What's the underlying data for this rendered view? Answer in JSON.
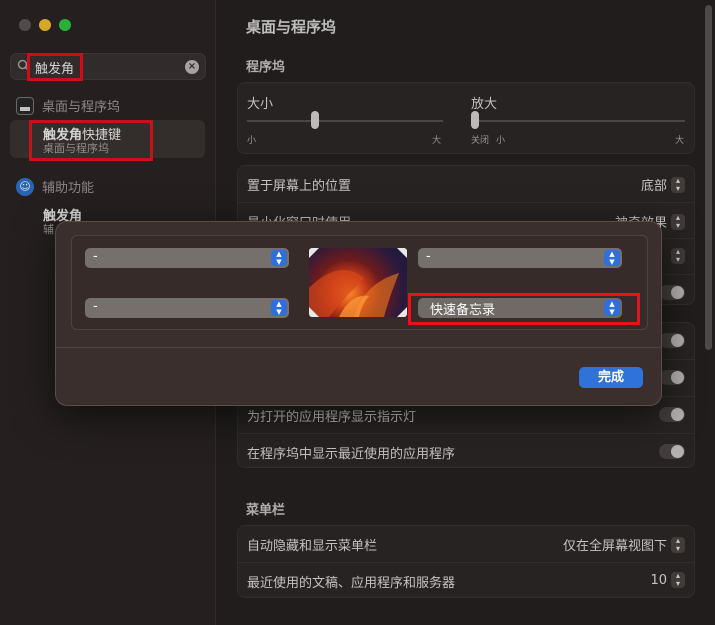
{
  "sidebar": {
    "search_value": "触发角",
    "clear_icon": "clear-icon",
    "results": [
      {
        "label": "桌面与程序坞",
        "icon": "dock-icon"
      },
      {
        "label": "辅助功能",
        "icon": "accessibility-icon"
      }
    ],
    "selected": {
      "title_bold": "触发角",
      "title_rest": "快捷键",
      "desc": "桌面与程序坞"
    },
    "second": {
      "title_bold": "触发角",
      "desc": "辅"
    }
  },
  "main": {
    "title": "桌面与程序坞",
    "dock_section": "程序坞",
    "size_label": "大小",
    "size_min": "小",
    "size_max": "大",
    "mag_label": "放大",
    "mag_off": "关闭",
    "mag_min": "小",
    "mag_max": "大",
    "position_label": "置于屏幕上的位置",
    "position_value": "底部",
    "minimize_label": "最小化窗口时使用",
    "minimize_value": "神奇效果",
    "indicator_label": "为打开的应用程序显示指示灯",
    "recent_label": "在程序坞中显示最近使用的应用程序",
    "menubar_section": "菜单栏",
    "autohide_label": "自动隐藏和显示菜单栏",
    "autohide_value": "仅在全屏幕视图下",
    "recent_docs_label": "最近使用的文稿、应用程序和服务器",
    "recent_docs_value": "10"
  },
  "dialog": {
    "top_left": "-",
    "top_right": "-",
    "bottom_left": "-",
    "bottom_right": "快速备忘录",
    "done": "完成"
  },
  "colors": {
    "accent": "#2f72d9",
    "highlight": "#e8111c"
  }
}
